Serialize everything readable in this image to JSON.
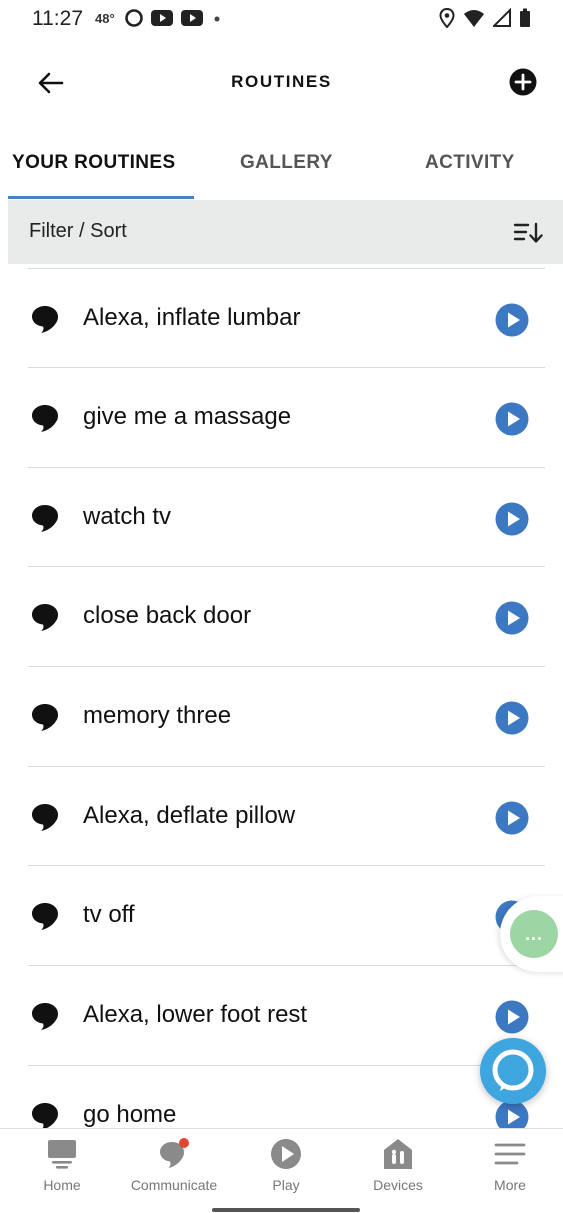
{
  "status_bar": {
    "time": "11:27",
    "temperature": "48°"
  },
  "header": {
    "title": "ROUTINES"
  },
  "tabs": [
    {
      "label": "YOUR ROUTINES",
      "active": true
    },
    {
      "label": "GALLERY",
      "active": false
    },
    {
      "label": "ACTIVITY",
      "active": false
    }
  ],
  "filter": {
    "label": "Filter / Sort"
  },
  "routines": [
    {
      "name": "Alexa, inflate lumbar"
    },
    {
      "name": "give me a massage"
    },
    {
      "name": "watch tv"
    },
    {
      "name": "close back door"
    },
    {
      "name": "memory three"
    },
    {
      "name": "Alexa, deflate pillow"
    },
    {
      "name": "tv off"
    },
    {
      "name": "Alexa, lower foot rest"
    },
    {
      "name": "go home"
    }
  ],
  "floating_more": {
    "label": "..."
  },
  "bottom_nav": [
    {
      "label": "Home",
      "icon": "home-icon"
    },
    {
      "label": "Communicate",
      "icon": "communicate-icon"
    },
    {
      "label": "Play",
      "icon": "play-icon"
    },
    {
      "label": "Devices",
      "icon": "devices-icon"
    },
    {
      "label": "More",
      "icon": "menu-icon"
    }
  ],
  "colors": {
    "accent_blue": "#3d78c2",
    "tab_underline": "#4a7fc4",
    "alexa_blue": "#3ea5de",
    "notification_red": "#e3452f",
    "floating_green": "#9dd6a4"
  }
}
